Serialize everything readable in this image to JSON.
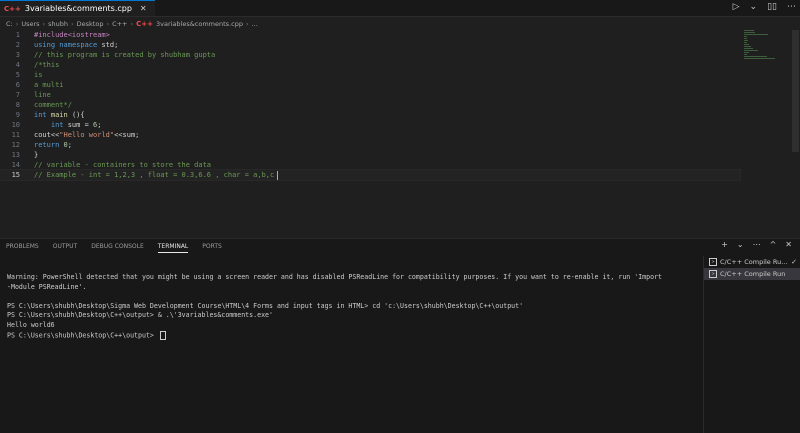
{
  "tab": {
    "badge": "C++",
    "filename": "3variables&comments.cpp"
  },
  "breadcrumb": [
    "C:",
    "Users",
    "shubh",
    "Desktop",
    "C++",
    "3variables&comments.cpp",
    "..."
  ],
  "editor": {
    "lines": [
      {
        "n": "1",
        "tokens": [
          [
            "pre",
            "#include<iostream>"
          ]
        ]
      },
      {
        "n": "2",
        "tokens": [
          [
            "kw",
            "using "
          ],
          [
            "kw",
            "namespace "
          ],
          [
            "txt",
            "std;"
          ]
        ]
      },
      {
        "n": "3",
        "tokens": [
          [
            "cmt",
            "// this program is created by shubham gupta"
          ]
        ]
      },
      {
        "n": "4",
        "tokens": [
          [
            "cmt",
            "/*this"
          ]
        ]
      },
      {
        "n": "5",
        "tokens": [
          [
            "cmt",
            "is"
          ]
        ]
      },
      {
        "n": "6",
        "tokens": [
          [
            "cmt",
            "a multi"
          ]
        ]
      },
      {
        "n": "7",
        "tokens": [
          [
            "cmt",
            "line"
          ]
        ]
      },
      {
        "n": "8",
        "tokens": [
          [
            "cmt",
            "comment*/"
          ]
        ]
      },
      {
        "n": "9",
        "tokens": [
          [
            "kw",
            "int "
          ],
          [
            "fn",
            "main "
          ],
          [
            "txt",
            "(){"
          ]
        ]
      },
      {
        "n": "10",
        "tokens": [
          [
            "txt",
            "    "
          ],
          [
            "kw",
            "int "
          ],
          [
            "txt",
            "sum = "
          ],
          [
            "num",
            "6"
          ],
          [
            "txt",
            ";"
          ]
        ]
      },
      {
        "n": "11",
        "tokens": [
          [
            "txt",
            "cout<<"
          ],
          [
            "str",
            "\"Hello world\""
          ],
          [
            "txt",
            "<<sum;"
          ]
        ]
      },
      {
        "n": "12",
        "tokens": [
          [
            "kw",
            "return "
          ],
          [
            "num",
            "0"
          ],
          [
            "txt",
            ";"
          ]
        ]
      },
      {
        "n": "13",
        "tokens": [
          [
            "txt",
            "}"
          ]
        ]
      },
      {
        "n": "14",
        "tokens": [
          [
            "cmt",
            "// variable - containers to store the data"
          ]
        ]
      },
      {
        "n": "15",
        "tokens": [
          [
            "cmt",
            "// Example - int = 1,2,3 , float = 0.3,6.6 , char = a,b,c"
          ]
        ]
      }
    ],
    "current_line": "15"
  },
  "panel": {
    "tabs": [
      "PROBLEMS",
      "OUTPUT",
      "DEBUG CONSOLE",
      "TERMINAL",
      "PORTS"
    ],
    "active_tab": "TERMINAL",
    "terminal_lines": [
      "Warning: PowerShell detected that you might be using a screen reader and has disabled PSReadLine for compatibility purposes. If you want to re-enable it, run 'Import",
      "-Module PSReadLine'.",
      "",
      "PS C:\\Users\\shubh\\Desktop\\Sigma Web Development Course\\HTML\\4 Forms and input tags in HTML> cd 'c:\\Users\\shubh\\Desktop\\C++\\output'",
      "PS C:\\Users\\shubh\\Desktop\\C++\\output> & .\\'3variables&comments.exe'",
      "Hello world6",
      "PS C:\\Users\\shubh\\Desktop\\C++\\output> "
    ],
    "terminals": [
      {
        "label": "C/C++ Compile Ru...",
        "checked": true
      },
      {
        "label": "C/C++ Compile Run",
        "checked": false
      }
    ]
  },
  "colors": {
    "accent": "#0078d4",
    "background": "#1f1f1f"
  }
}
